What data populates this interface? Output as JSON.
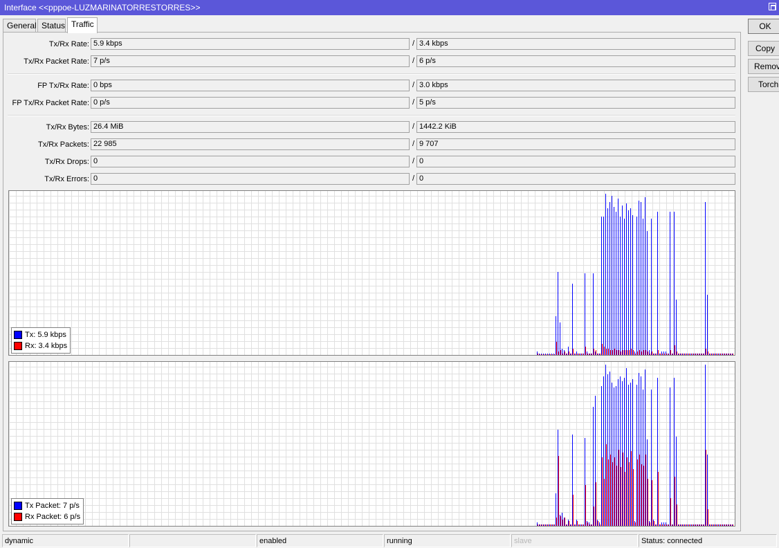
{
  "window": {
    "title": "Interface <<pppoe-LUZMARINATORRESTORRES>>"
  },
  "tabs": [
    "General",
    "Status",
    "Traffic"
  ],
  "active_tab": "Traffic",
  "fields": {
    "rate": {
      "label": "Tx/Rx Rate:",
      "tx": "5.9 kbps",
      "rx": "3.4 kbps"
    },
    "packet_rate": {
      "label": "Tx/Rx Packet Rate:",
      "tx": "7 p/s",
      "rx": "6 p/s"
    },
    "fp_rate": {
      "label": "FP Tx/Rx Rate:",
      "tx": "0 bps",
      "rx": "3.0 kbps"
    },
    "fp_packet_rate": {
      "label": "FP Tx/Rx Packet Rate:",
      "tx": "0 p/s",
      "rx": "5 p/s"
    },
    "bytes": {
      "label": "Tx/Rx Bytes:",
      "tx": "26.4 MiB",
      "rx": "1442.2 KiB"
    },
    "packets": {
      "label": "Tx/Rx Packets:",
      "tx": "22 985",
      "rx": "9 707"
    },
    "drops": {
      "label": "Tx/Rx Drops:",
      "tx": "0",
      "rx": "0"
    },
    "errors": {
      "label": "Tx/Rx Errors:",
      "tx": "0",
      "rx": "0"
    },
    "separator": "/"
  },
  "buttons": {
    "ok": "OK",
    "copy": "Copy",
    "remove": "Remove",
    "torch": "Torch"
  },
  "legend_traffic": {
    "tx": "Tx:  5.9 kbps",
    "rx": "Rx:  3.4 kbps"
  },
  "legend_packets": {
    "tx": "Tx Packet:  7 p/s",
    "rx": "Rx Packet:  6 p/s"
  },
  "colors": {
    "tx": "#0000ff",
    "rx": "#ff0000",
    "title_bar": "#5b57d9",
    "grid": "#e0e0e0"
  },
  "status_bar": [
    "dynamic",
    "",
    "enabled",
    "running",
    "slave",
    "Status: connected"
  ],
  "chart_data": [
    {
      "type": "bar",
      "name": "traffic",
      "ylim": [
        0,
        1
      ],
      "series": [
        {
          "name": "Tx",
          "values": [
            0.02,
            0.01,
            0.01,
            0.01,
            0.01,
            0.01,
            0.01,
            0.01,
            0.01,
            0.24,
            0.51,
            0.2,
            0.04,
            0.03,
            0.01,
            0.05,
            0.01,
            0.44,
            0.01,
            0.02,
            0.01,
            0.01,
            0.01,
            0.5,
            0.02,
            0.01,
            0.01,
            0.5,
            0.02,
            0.01,
            0.01,
            0.85,
            0.85,
            0.99,
            0.9,
            0.94,
            0.98,
            0.91,
            0.88,
            0.96,
            0.85,
            0.92,
            0.84,
            0.93,
            0.89,
            0.9,
            0.86,
            0.02,
            0.85,
            0.95,
            0.94,
            0.84,
            0.97,
            0.76,
            0.03,
            0.84,
            0.01,
            0.01,
            0.88,
            0.01,
            0.02,
            0.02,
            0.02,
            0.01,
            0.88,
            0.01,
            0.88,
            0.34,
            0.01,
            0.01,
            0.01,
            0.01,
            0.01,
            0.01,
            0.01,
            0.01,
            0.01,
            0.01,
            0.01,
            0.01,
            0.01,
            0.94,
            0.37,
            0.01,
            0.01,
            0.01,
            0.01,
            0.01,
            0.01,
            0.01,
            0.01,
            0.01,
            0.01,
            0.01,
            0.01
          ]
        },
        {
          "name": "Rx",
          "values": [
            0.01,
            0.0,
            0.0,
            0.0,
            0.0,
            0.0,
            0.0,
            0.0,
            0.0,
            0.08,
            0.02,
            0.03,
            0.01,
            0.02,
            0.01,
            0.02,
            0.01,
            0.04,
            0.01,
            0.01,
            0.01,
            0.01,
            0.01,
            0.05,
            0.01,
            0.01,
            0.01,
            0.04,
            0.03,
            0.01,
            0.01,
            0.07,
            0.05,
            0.04,
            0.04,
            0.03,
            0.03,
            0.04,
            0.03,
            0.03,
            0.02,
            0.03,
            0.03,
            0.03,
            0.03,
            0.04,
            0.03,
            0.01,
            0.02,
            0.03,
            0.02,
            0.03,
            0.03,
            0.02,
            0.01,
            0.02,
            0.01,
            0.01,
            0.03,
            0.01,
            0.01,
            0.01,
            0.01,
            0.01,
            0.03,
            0.01,
            0.06,
            0.02,
            0.01,
            0.01,
            0.01,
            0.01,
            0.01,
            0.01,
            0.01,
            0.01,
            0.01,
            0.01,
            0.01,
            0.01,
            0.01,
            0.04,
            0.02,
            0.01,
            0.01,
            0.01,
            0.01,
            0.01,
            0.01,
            0.01,
            0.01,
            0.01,
            0.01,
            0.01,
            0.01
          ]
        }
      ]
    },
    {
      "type": "bar",
      "name": "packets",
      "ylim": [
        0,
        1
      ],
      "series": [
        {
          "name": "Tx Packet",
          "values": [
            0.02,
            0.01,
            0.01,
            0.01,
            0.01,
            0.01,
            0.01,
            0.01,
            0.01,
            0.2,
            0.59,
            0.07,
            0.08,
            0.05,
            0.01,
            0.04,
            0.01,
            0.56,
            0.01,
            0.04,
            0.01,
            0.01,
            0.01,
            0.54,
            0.03,
            0.02,
            0.01,
            0.73,
            0.8,
            0.04,
            0.02,
            0.86,
            0.92,
            0.99,
            0.93,
            0.95,
            0.88,
            0.85,
            0.86,
            0.9,
            0.92,
            0.89,
            0.91,
            0.97,
            0.87,
            0.88,
            0.9,
            0.03,
            0.87,
            0.94,
            0.92,
            0.84,
            0.96,
            0.53,
            0.03,
            0.84,
            0.04,
            0.01,
            0.91,
            0.01,
            0.02,
            0.02,
            0.02,
            0.01,
            0.85,
            0.01,
            0.91,
            0.55,
            0.01,
            0.01,
            0.01,
            0.01,
            0.01,
            0.01,
            0.01,
            0.01,
            0.01,
            0.01,
            0.01,
            0.01,
            0.01,
            0.99,
            0.44,
            0.01,
            0.01,
            0.01,
            0.01,
            0.01,
            0.01,
            0.01,
            0.01,
            0.01,
            0.01,
            0.01,
            0.01
          ]
        },
        {
          "name": "Rx Packet",
          "values": [
            0.01,
            0.01,
            0.01,
            0.01,
            0.01,
            0.01,
            0.01,
            0.01,
            0.01,
            0.05,
            0.43,
            0.06,
            0.04,
            0.05,
            0.01,
            0.03,
            0.01,
            0.19,
            0.01,
            0.03,
            0.01,
            0.01,
            0.01,
            0.25,
            0.02,
            0.01,
            0.01,
            0.12,
            0.27,
            0.03,
            0.01,
            0.42,
            0.29,
            0.5,
            0.41,
            0.44,
            0.39,
            0.42,
            0.37,
            0.47,
            0.36,
            0.45,
            0.33,
            0.42,
            0.39,
            0.46,
            0.35,
            0.02,
            0.41,
            0.44,
            0.38,
            0.37,
            0.44,
            0.29,
            0.02,
            0.28,
            0.03,
            0.01,
            0.33,
            0.01,
            0.01,
            0.01,
            0.01,
            0.01,
            0.17,
            0.01,
            0.3,
            0.13,
            0.01,
            0.01,
            0.01,
            0.01,
            0.01,
            0.01,
            0.01,
            0.01,
            0.01,
            0.01,
            0.01,
            0.01,
            0.01,
            0.47,
            0.1,
            0.01,
            0.01,
            0.01,
            0.01,
            0.01,
            0.01,
            0.01,
            0.01,
            0.01,
            0.01,
            0.01,
            0.01
          ]
        }
      ]
    }
  ]
}
